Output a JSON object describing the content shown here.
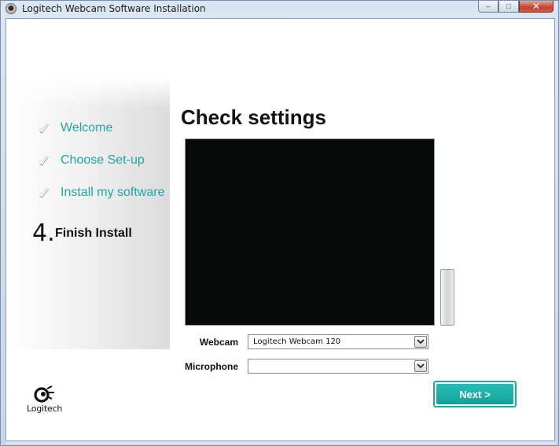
{
  "window": {
    "title": "Logitech Webcam Software Installation",
    "caption_minimize": "–",
    "caption_maximize": "□",
    "caption_close": "✕"
  },
  "sidebar": {
    "steps": [
      {
        "label": "Welcome",
        "state": "done",
        "icon": "check-icon"
      },
      {
        "label": "Choose Set-up",
        "state": "done",
        "icon": "check-icon"
      },
      {
        "label": "Install my software",
        "state": "done",
        "icon": "check-icon"
      },
      {
        "number": "4.",
        "label": "Finish Install",
        "state": "current"
      }
    ],
    "check_glyph": "✓"
  },
  "main": {
    "heading": "Check settings",
    "webcam": {
      "label": "Webcam",
      "value": "Logitech Webcam 120"
    },
    "microphone": {
      "label": "Microphone",
      "value": ""
    }
  },
  "buttons": {
    "next": "Next >"
  },
  "logo": {
    "text": "Logitech"
  },
  "colors": {
    "accent": "#1fa7a4",
    "button": "#1aa9a3",
    "preview_bg": "#060b09"
  }
}
